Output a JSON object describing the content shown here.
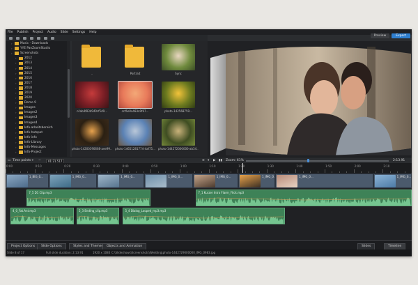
{
  "menu": [
    "File",
    "Publish",
    "Project",
    "Audio",
    "Slide",
    "Settings",
    "Help"
  ],
  "header": {
    "preview_label": "Preview",
    "export_label": "Export"
  },
  "tree": [
    {
      "label": "Music - Downloads",
      "level": 1
    },
    {
      "label": "YYE PanZoomStudio",
      "level": 1
    },
    {
      "label": "Screenshots",
      "level": 1
    },
    {
      "label": "2012",
      "level": 2
    },
    {
      "label": "2013",
      "level": 2
    },
    {
      "label": "2014",
      "level": 2
    },
    {
      "label": "2015",
      "level": 2
    },
    {
      "label": "2016",
      "level": 2
    },
    {
      "label": "2017",
      "level": 2
    },
    {
      "label": "2018",
      "level": 2
    },
    {
      "label": "2019",
      "level": 2
    },
    {
      "label": "2020",
      "level": 2
    },
    {
      "label": "Demo 9",
      "level": 2
    },
    {
      "label": "Images",
      "level": 2
    },
    {
      "label": "Images2",
      "level": 2
    },
    {
      "label": "Images3",
      "level": 2
    },
    {
      "label": "Images4",
      "level": 2
    },
    {
      "label": "Info-arbeitsbereich",
      "level": 2
    },
    {
      "label": "Info-hotspot",
      "level": 2
    },
    {
      "label": "Info-info",
      "level": 2
    },
    {
      "label": "Info-Library",
      "level": 2
    },
    {
      "label": "Info-Messages",
      "level": 2
    },
    {
      "label": "Info-Project",
      "level": 2
    }
  ],
  "files": [
    {
      "name": "..",
      "kind": "folder"
    },
    {
      "name": "Portrait",
      "kind": "folder"
    },
    {
      "name": "Sync",
      "kind": "image",
      "colors": [
        "#6f8a3d",
        "#e9d7c0",
        "#3b4d25"
      ]
    },
    {
      "name": "c4ab4f83d949cf5d9...",
      "kind": "image",
      "colors": [
        "#7a1e25",
        "#c53b3b",
        "#3b1417"
      ]
    },
    {
      "name": "ccf6e0a483a9f67...",
      "kind": "image",
      "colors": [
        "#e87a5a",
        "#f3a877",
        "#b24a3d"
      ]
    },
    {
      "name": "photo-142568759...",
      "kind": "image",
      "colors": [
        "#6c7a1f",
        "#f2c33a",
        "#2f3b14"
      ]
    },
    {
      "name": "photo-14200390668-aee99...",
      "kind": "image",
      "colors": [
        "#2b2013",
        "#e7a24d",
        "#3d2c1c"
      ]
    },
    {
      "name": "photo-14651281774-4af75...",
      "kind": "image",
      "colors": [
        "#5b82b5",
        "#b9c7d8",
        "#6e5a45"
      ]
    },
    {
      "name": "photo-144272000000-ab34...",
      "kind": "image",
      "colors": [
        "#3f4d22",
        "#c9b27a",
        "#778b3b"
      ]
    }
  ],
  "controls": {
    "timepoints_label": "Time points",
    "time_value": "01:21.517",
    "zoom_label": "Zoom: 61%",
    "time_total": "2:13.91"
  },
  "ruler_labels": [
    "0:00",
    "0:10",
    "0:20",
    "0:30",
    "0:40",
    "0:50",
    "1:00",
    "1:10",
    "1:20",
    "1:30",
    "1:40",
    "1:50",
    "2:00",
    "2:10"
  ],
  "video_clips": [
    {
      "name": "1_BIG_0...",
      "start": 0.0,
      "end": 0.106,
      "colors": [
        "#8aa7c2",
        "#4d6b8a"
      ]
    },
    {
      "name": "1_IMG_0...",
      "start": 0.106,
      "end": 0.225,
      "colors": [
        "#7ea3bb",
        "#3e6b87"
      ]
    },
    {
      "name": "1_IMG_0...",
      "start": 0.225,
      "end": 0.342,
      "colors": [
        "#9fb6c8",
        "#57748e"
      ]
    },
    {
      "name": "1_IMG_0...",
      "start": 0.342,
      "end": 0.461,
      "colors": [
        "#6f8fa9",
        "#a9bccb"
      ]
    },
    {
      "name": "1_IMG_0...",
      "start": 0.461,
      "end": 0.573,
      "colors": [
        "#c5a58a",
        "#4b3a2e"
      ]
    },
    {
      "name": "1_IMG_0...",
      "start": 0.573,
      "end": 0.664,
      "colors": [
        "#e8a24a",
        "#3b2f24"
      ]
    },
    {
      "name": "1_IMG_0...",
      "start": 0.664,
      "end": 0.905,
      "colors": [
        "#b88c7a",
        "#e7d2c3"
      ]
    },
    {
      "name": "1_IMG_0...",
      "start": 0.905,
      "end": 1.0,
      "colors": [
        "#8cb3d6",
        "#4d7ba6"
      ]
    }
  ],
  "audio_tracks": [
    [
      {
        "name": "7_5 D1 Clip.mp3",
        "start": 0.052,
        "end": 0.356
      },
      {
        "name": "7_1 Kurzer Intro Flarm_Flick.mp3",
        "start": 0.469,
        "end": 1.0
      }
    ],
    [
      {
        "name": "4_0_Fat.Ant.mp3",
        "start": 0.012,
        "end": 0.168
      },
      {
        "name": "5_3 Ending_clip.mp3",
        "start": 0.175,
        "end": 0.279
      },
      {
        "name": "5_4 Dialog_Looped_mp3.mp3",
        "start": 0.289,
        "end": 0.687
      }
    ]
  ],
  "tabs": [
    "Project Options",
    "Slide Options",
    "Styles and Themes",
    "Objects and Animation"
  ],
  "tabs_right": [
    "Slides",
    "Timeline"
  ],
  "status": {
    "left": "Slide 8 of 17",
    "middle": "Full slide duration: 2:13.91",
    "dims": "1920 x 1080",
    "path": "C:\\Slideshows\\Screenshots\\Wedding\\photo-1442729000000_IMG_0983.jpg"
  }
}
